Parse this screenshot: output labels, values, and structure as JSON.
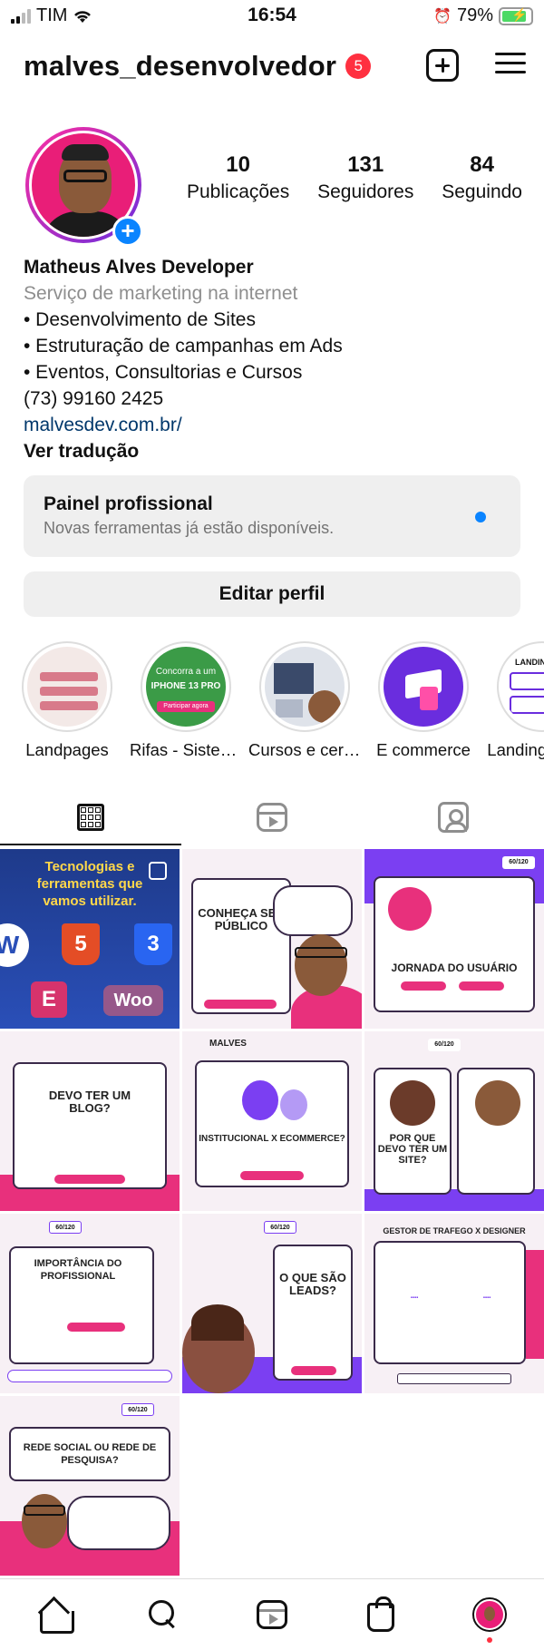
{
  "status_bar": {
    "carrier": "TIM",
    "time": "16:54",
    "battery": "79%"
  },
  "header": {
    "username": "malves_desenvolvedor",
    "notification_count": "5"
  },
  "profile": {
    "stats": [
      {
        "value": "10",
        "label": "Publicações"
      },
      {
        "value": "131",
        "label": "Seguidores"
      },
      {
        "value": "84",
        "label": "Seguindo"
      }
    ],
    "name": "Matheus Alves Developer",
    "category": "Serviço de marketing na internet",
    "bio_lines": [
      "• Desenvolvimento de Sites",
      "• Estruturação de campanhas em Ads",
      "• Eventos, Consultorias e Cursos",
      "(73) 99160 2425"
    ],
    "link": "malvesdev.com.br/",
    "translate": "Ver tradução"
  },
  "professional_panel": {
    "title": "Painel profissional",
    "subtitle": "Novas ferramentas já estão disponíveis."
  },
  "edit_profile_label": "Editar perfil",
  "highlights": [
    {
      "label": "Landpages"
    },
    {
      "label": "Rifas - Sistema"
    },
    {
      "label": "Cursos e certificados"
    },
    {
      "label": "E commerce"
    },
    {
      "label": "Landing pages"
    }
  ],
  "highlight_texts": {
    "rifas_line1": "Concorra a um",
    "rifas_line2": "IPHONE 13 PRO",
    "rifas_button": "Participar agora",
    "landing": "LANDIN"
  },
  "posts": [
    {
      "title": "Tecnologias e ferramentas que vamos utilizar."
    },
    {
      "title": "CONHEÇA SEU PÚBLICO"
    },
    {
      "title": "JORNADA DO USUÁRIO"
    },
    {
      "title": "DEVO TER UM BLOG?"
    },
    {
      "title": "INSTITUCIONAL X ECOMMERCE?",
      "brand": "MALVES"
    },
    {
      "title": "POR QUE DEVO TER UM SITE?"
    },
    {
      "title": "IMPORTÂNCIA DO PROFISSIONAL"
    },
    {
      "title": "O QUE SÃO LEADS?"
    },
    {
      "title": "GESTOR DE TRAFEGO X DESIGNER"
    },
    {
      "title": "REDE SOCIAL OU REDE DE PESQUISA?"
    }
  ],
  "post_counter": "60/120",
  "tech_logos": {
    "html": "5",
    "css": "3",
    "woo": "Woo",
    "elementor": "E",
    "wp": "W"
  },
  "colors": {
    "accent_pink": "#e8307c",
    "accent_purple": "#7b3ff2",
    "link_blue": "#00376b",
    "notification_red": "#ff3040",
    "info_blue": "#0a84ff"
  },
  "icons": {
    "header_add": "plus-square-icon",
    "header_menu": "hamburger-menu-icon",
    "tab_grid": "grid-icon",
    "tab_reels": "reels-icon",
    "tab_tagged": "tagged-icon",
    "nav_home": "home-icon",
    "nav_search": "search-icon",
    "nav_reels": "reels-icon",
    "nav_shop": "shopping-bag-icon",
    "nav_profile": "avatar"
  }
}
